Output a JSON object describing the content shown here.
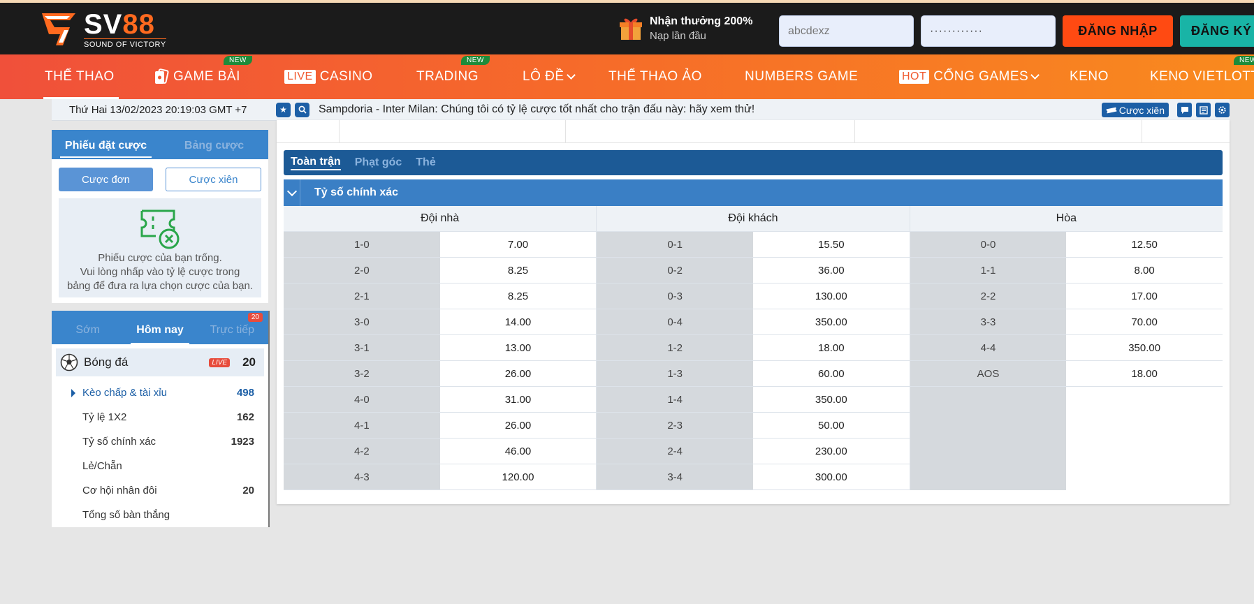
{
  "header": {
    "logo_title": "SV",
    "logo_num": "88",
    "logo_sub": "SOUND OF VICTORY",
    "promo_title": "Nhận thưởng 200%",
    "promo_sub": "Nạp lần đầu",
    "username_value": "abcdexz",
    "password_value": "············",
    "login_label": "ĐĂNG NHẬP",
    "register_label": "ĐĂNG KÝ"
  },
  "nav": {
    "items": [
      {
        "label": "THỂ THAO"
      },
      {
        "label": "GAME BÀI",
        "badge": "NEW"
      },
      {
        "tag": "LIVE",
        "label": "CASINO"
      },
      {
        "label": "TRADING",
        "badge": "NEW"
      },
      {
        "label": "LÔ ĐỀ"
      },
      {
        "label": "THỂ THAO ẢO"
      },
      {
        "label": "NUMBERS GAME"
      },
      {
        "tag": "HOT",
        "label": "CỔNG GAMES"
      },
      {
        "label": "KENO"
      },
      {
        "label": "KENO VIETLOTT",
        "badge": "NEW"
      }
    ]
  },
  "ticker": {
    "datetime": "Thứ Hai 13/02/2023 20:19:03 GMT +7",
    "message": "Sampdoria - Inter Milan: Chúng tôi có tỷ lệ cược tốt nhất cho trận đấu này: hãy xem thử!",
    "parlay_label": "Cược xiên"
  },
  "betslip": {
    "tab_active": "Phiếu đặt cược",
    "tab_other": "Bảng cược",
    "mode_single": "Cược đơn",
    "mode_parlay": "Cược xiên",
    "empty_line1": "Phiếu cược của bạn trống.",
    "empty_line2": "Vui lòng nhấp vào tỷ lệ cược trong",
    "empty_line3": "bảng để đưa ra lựa chọn cược của bạn."
  },
  "sports": {
    "tab_early": "Sớm",
    "tab_today": "Hôm nay",
    "tab_live": "Trực tiếp",
    "live_count": "20",
    "sport_name": "Bóng đá",
    "live_badge": "LIVE",
    "sport_count": "20",
    "markets": [
      {
        "name": "Kèo chấp & tài xỉu",
        "count": "498"
      },
      {
        "name": "Tỷ lệ 1X2",
        "count": "162"
      },
      {
        "name": "Tỷ số chính xác",
        "count": "1923"
      },
      {
        "name": "Lẻ/Chẵn",
        "count": ""
      },
      {
        "name": "Cơ hội nhân đôi",
        "count": "20"
      },
      {
        "name": "Tổng số bàn thắng",
        "count": ""
      }
    ]
  },
  "main": {
    "period_tabs": [
      "Toàn trận",
      "Phạt góc",
      "Thẻ"
    ],
    "market_title": "Tỷ số chính xác",
    "columns": [
      {
        "title": "Đội nhà",
        "rows": [
          [
            "1-0",
            "7.00"
          ],
          [
            "2-0",
            "8.25"
          ],
          [
            "2-1",
            "8.25"
          ],
          [
            "3-0",
            "14.00"
          ],
          [
            "3-1",
            "13.00"
          ],
          [
            "3-2",
            "26.00"
          ],
          [
            "4-0",
            "31.00"
          ],
          [
            "4-1",
            "26.00"
          ],
          [
            "4-2",
            "46.00"
          ],
          [
            "4-3",
            "120.00"
          ]
        ]
      },
      {
        "title": "Đội khách",
        "rows": [
          [
            "0-1",
            "15.50"
          ],
          [
            "0-2",
            "36.00"
          ],
          [
            "0-3",
            "130.00"
          ],
          [
            "0-4",
            "350.00"
          ],
          [
            "1-2",
            "18.00"
          ],
          [
            "1-3",
            "60.00"
          ],
          [
            "1-4",
            "350.00"
          ],
          [
            "2-3",
            "50.00"
          ],
          [
            "2-4",
            "230.00"
          ],
          [
            "3-4",
            "300.00"
          ]
        ]
      },
      {
        "title": "Hòa",
        "rows": [
          [
            "0-0",
            "12.50"
          ],
          [
            "1-1",
            "8.00"
          ],
          [
            "2-2",
            "17.00"
          ],
          [
            "3-3",
            "70.00"
          ],
          [
            "4-4",
            "350.00"
          ],
          [
            "AOS",
            "18.00"
          ]
        ]
      }
    ]
  },
  "colors": {
    "brand_orange": "#ff4a12",
    "brand_teal": "#19b4a6",
    "primary_blue": "#3a85cc",
    "dark_blue": "#1c5a96"
  }
}
